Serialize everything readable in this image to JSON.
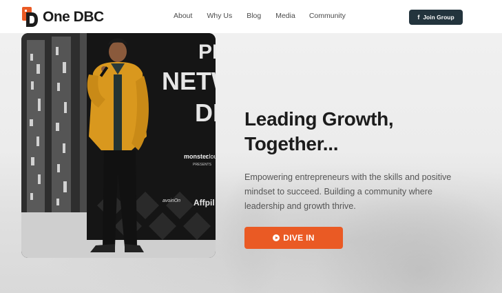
{
  "header": {
    "brand": "One DBC",
    "nav": [
      "About",
      "Why Us",
      "Blog",
      "Media",
      "Community"
    ],
    "join_label": "Join Group",
    "join_icon": "facebook-icon"
  },
  "photo": {
    "banner_lines": [
      "PR",
      "NETW",
      "DI"
    ],
    "sponsor_1": "monster",
    "sponsor_1b": "cloud",
    "sponsor_1_sub": "PRESENTS",
    "sponsor_2": "Affpil",
    "sponsor_3": "avoinOn"
  },
  "hero": {
    "headline_line1": "Leading Growth,",
    "headline_line2": "Together...",
    "subtext": "Empowering entrepreneurs with the skills and positive mindset to succeed. Building a community where leadership and growth thrive.",
    "cta_label": "DIVE IN",
    "cta_icon": "play-circle-icon"
  },
  "colors": {
    "accent": "#ea5a24",
    "dark": "#23343d",
    "text": "#1c1c1c"
  }
}
